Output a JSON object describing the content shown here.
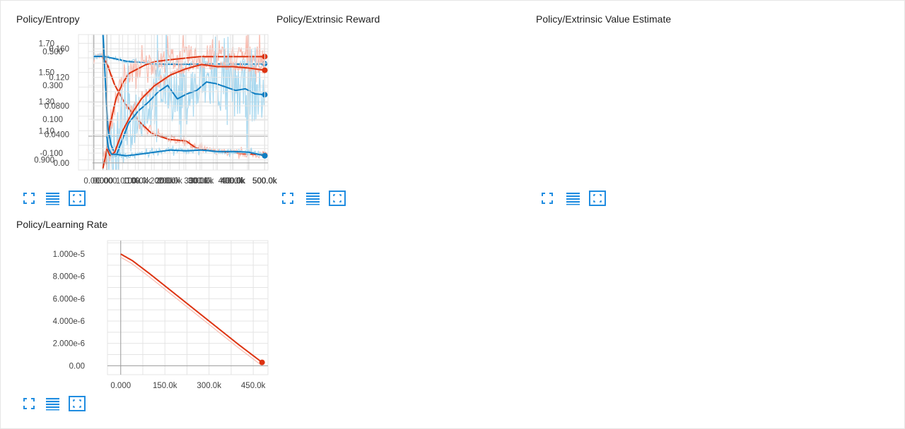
{
  "colors": {
    "red": "#dd3311",
    "red_light": "#f8bcb0",
    "blue": "#0f7ec2",
    "blue_light": "#a8d8ef",
    "grid": "#e4e4e4",
    "axis": "#9e9e9e",
    "icon": "#1f8ce0"
  },
  "icons": [
    "fullscreen-icon",
    "data-list-icon",
    "fit-domain-icon"
  ],
  "chart_data": [
    {
      "type": "line",
      "title": "Policy/Entropy",
      "xlabel": "",
      "ylabel": "",
      "xlim": [
        -45000,
        510000
      ],
      "ylim": [
        0.83,
        1.76
      ],
      "x_ticks": [
        0,
        100000,
        200000,
        300000,
        400000,
        500000
      ],
      "x_tick_labels": [
        "0.000",
        "100.0k",
        "200.0k",
        "300.0k",
        "400.0k",
        "500.0k"
      ],
      "y_ticks": [
        0.9,
        1.1,
        1.3,
        1.5,
        1.7
      ],
      "y_tick_labels": [
        "0.900",
        "1.10",
        "1.30",
        "1.50",
        "1.70"
      ],
      "grid": true,
      "series": [
        {
          "color": "red",
          "noise": 0.02,
          "x": [
            0,
            25000,
            40000,
            60000,
            90000,
            130000,
            170000,
            220000,
            270000,
            300000,
            350000,
            400000,
            450000,
            500000
          ],
          "y": [
            1.61,
            1.61,
            1.55,
            1.42,
            1.29,
            1.17,
            1.08,
            1.04,
            1.03,
            0.98,
            0.96,
            0.95,
            0.94,
            0.935
          ]
        },
        {
          "color": "blue",
          "noise": 0.015,
          "x": [
            0,
            30000,
            60000,
            100000,
            150000,
            200000,
            250000,
            300000,
            350000,
            400000,
            450000,
            500000
          ],
          "y": [
            1.61,
            1.61,
            1.595,
            1.575,
            1.565,
            1.558,
            1.555,
            1.558,
            1.56,
            1.558,
            1.558,
            1.56
          ]
        }
      ]
    },
    {
      "type": "line",
      "title": "Policy/Extrinsic Reward",
      "xlabel": "",
      "ylabel": "",
      "xlim": [
        -45000,
        510000
      ],
      "ylim": [
        -0.2,
        0.6
      ],
      "x_ticks": [
        0,
        100000,
        200000,
        300000,
        400000,
        500000
      ],
      "x_tick_labels": [
        "0.000",
        "100.0k",
        "200.0k",
        "300.0k",
        "400.0k",
        "500.0k"
      ],
      "y_ticks": [
        -0.1,
        0.1,
        0.3,
        0.5
      ],
      "y_tick_labels": [
        "-0.100",
        "0.100",
        "0.300",
        "0.500"
      ],
      "zero_line": true,
      "grid": true,
      "series": [
        {
          "color": "red",
          "noise": 0.07,
          "x": [
            0,
            10000,
            20000,
            40000,
            60000,
            80000,
            100000,
            130000,
            160000,
            200000,
            250000,
            300000,
            350000,
            400000,
            450000,
            500000
          ],
          "y": [
            -0.19,
            -0.1,
            0.05,
            0.22,
            0.31,
            0.37,
            0.39,
            0.42,
            0.44,
            0.45,
            0.46,
            0.47,
            0.47,
            0.47,
            0.47,
            0.47
          ]
        },
        {
          "color": "blue",
          "noise": 0.18,
          "x": [
            0,
            3000,
            8000,
            15000,
            25000,
            40000,
            60000,
            80000,
            110000,
            140000,
            170000,
            200000,
            230000,
            260000,
            290000,
            320000,
            350000,
            380000,
            410000,
            440000,
            470000,
            500000
          ],
          "y": [
            0.6,
            0.5,
            0.3,
            0.05,
            -0.05,
            -0.12,
            -0.02,
            0.08,
            0.15,
            0.2,
            0.26,
            0.3,
            0.22,
            0.25,
            0.27,
            0.32,
            0.31,
            0.29,
            0.27,
            0.28,
            0.25,
            0.245
          ]
        }
      ]
    },
    {
      "type": "line",
      "title": "Policy/Extrinsic Value Estimate",
      "xlabel": "",
      "ylabel": "",
      "xlim": [
        -45000,
        510000
      ],
      "ylim": [
        -0.01,
        0.18
      ],
      "x_ticks": [
        0,
        100000,
        200000,
        300000,
        400000,
        500000
      ],
      "x_tick_labels": [
        "0.000",
        "100.0k",
        "200.0k",
        "300.0k",
        "400.0k",
        "500.0k"
      ],
      "y_ticks": [
        0,
        0.04,
        0.08,
        0.12,
        0.16
      ],
      "y_tick_labels": [
        "0.00",
        "0.0400",
        "0.0800",
        "0.120",
        "0.160"
      ],
      "zero_line": true,
      "grid": true,
      "series": [
        {
          "color": "red",
          "noise": 0.02,
          "x": [
            0,
            10000,
            25000,
            50000,
            80000,
            110000,
            150000,
            200000,
            250000,
            300000,
            350000,
            400000,
            450000,
            500000
          ],
          "y": [
            0.02,
            0.01,
            0.015,
            0.045,
            0.07,
            0.09,
            0.108,
            0.123,
            0.132,
            0.138,
            0.135,
            0.135,
            0.133,
            0.13
          ]
        },
        {
          "color": "blue",
          "noise": 0.015,
          "x": [
            0,
            5000,
            15000,
            30000,
            60000,
            100000,
            150000,
            200000,
            250000,
            300000,
            350000,
            400000,
            450000,
            500000
          ],
          "y": [
            0.037,
            0.02,
            0.012,
            0.012,
            0.01,
            0.012,
            0.015,
            0.018,
            0.017,
            0.018,
            0.016,
            0.016,
            0.015,
            0.01
          ]
        }
      ]
    },
    {
      "type": "line",
      "title": "Policy/Learning Rate",
      "xlabel": "",
      "ylabel": "",
      "xlim": [
        -45000,
        500000
      ],
      "ylim": [
        -8e-07,
        1.12e-05
      ],
      "x_ticks": [
        0,
        150000,
        300000,
        450000
      ],
      "x_tick_labels": [
        "0.000",
        "150.0k",
        "300.0k",
        "450.0k"
      ],
      "y_ticks": [
        0,
        2e-06,
        4e-06,
        6e-06,
        8e-06,
        1e-05
      ],
      "y_tick_labels": [
        "0.00",
        "2.000e-6",
        "4.000e-6",
        "6.000e-6",
        "8.000e-6",
        "1.000e-5"
      ],
      "zero_line": true,
      "grid": true,
      "series": [
        {
          "color": "red",
          "noise": 0,
          "x": [
            0,
            20000,
            40000,
            60000,
            100000,
            200000,
            300000,
            400000,
            480000
          ],
          "y": [
            1e-05,
            9.7e-06,
            9.4e-06,
            9e-06,
            8.2e-06,
            6.1e-06,
            4e-06,
            1.9e-06,
            3e-07
          ]
        }
      ]
    }
  ]
}
